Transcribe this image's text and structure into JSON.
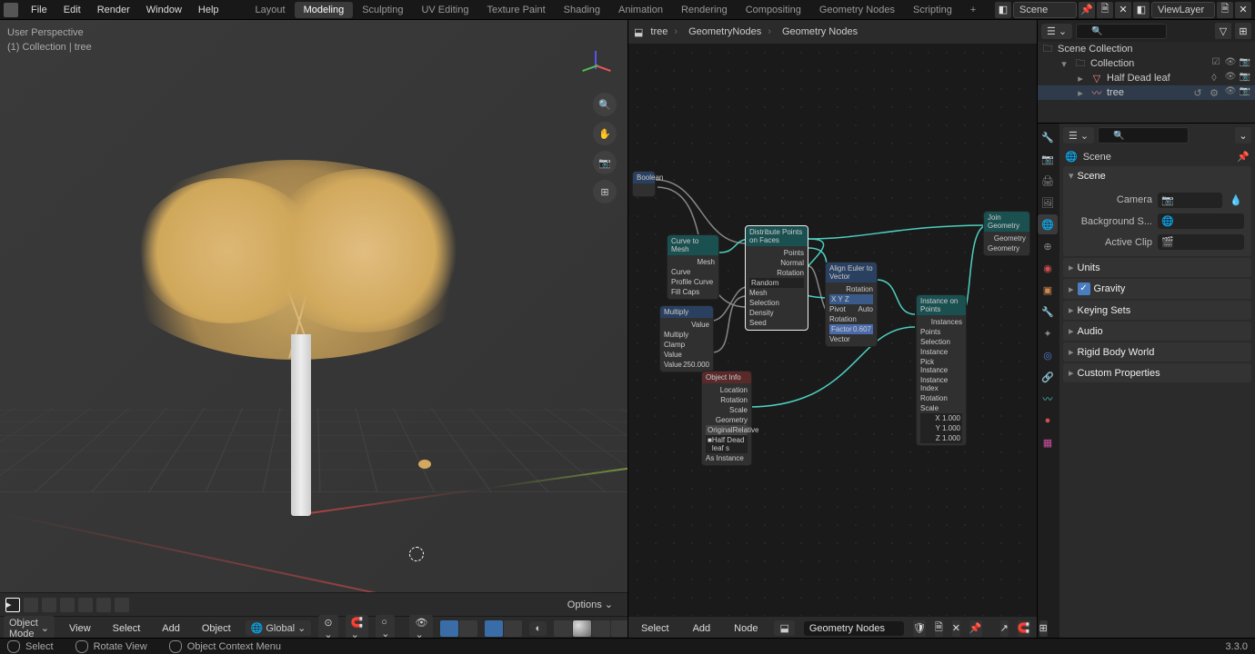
{
  "topbar": {
    "menus": [
      "File",
      "Edit",
      "Render",
      "Window",
      "Help"
    ],
    "workspaces": [
      "Layout",
      "Modeling",
      "Sculpting",
      "UV Editing",
      "Texture Paint",
      "Shading",
      "Animation",
      "Rendering",
      "Compositing",
      "Geometry Nodes",
      "Scripting"
    ],
    "active_workspace": "Modeling",
    "scene": "Scene",
    "view_layer": "ViewLayer"
  },
  "viewport": {
    "header_line1": "User Perspective",
    "header_line2": "(1) Collection | tree",
    "mode": "Object Mode",
    "menu": [
      "View",
      "Select",
      "Add",
      "Object"
    ],
    "orientation": "Global",
    "options": "Options"
  },
  "node_editor": {
    "breadcrumb": [
      "tree",
      "GeometryNodes",
      "Geometry Nodes"
    ],
    "menu": [
      "Select",
      "Add",
      "Node"
    ],
    "modifier_name": "Geometry Nodes",
    "nodes": {
      "boolean": "Boolean",
      "curve_to_mesh": {
        "title": "Curve to Mesh",
        "out": "Mesh",
        "in1": "Curve",
        "in2": "Profile Curve",
        "in3": "Fill Caps"
      },
      "multiply": {
        "title": "Multiply",
        "out": "Value",
        "op": "Multiply",
        "clamp": "Clamp",
        "in1": "Value",
        "in2": "Value",
        "val": "250.000"
      },
      "distribute": {
        "title": "Distribute Points on Faces",
        "o1": "Points",
        "o2": "Normal",
        "o3": "Rotation",
        "mode": "Random",
        "i1": "Mesh",
        "i2": "Selection",
        "i3": "Density",
        "i4": "Seed"
      },
      "align": {
        "title": "Align Euler to Vector",
        "out": "Rotation",
        "axes": "X  Y  Z",
        "pivot_lbl": "Pivot",
        "pivot": "Auto",
        "in1": "Rotation",
        "factor_lbl": "Factor",
        "factor": "0.607",
        "in2": "Vector"
      },
      "instance": {
        "title": "Instance on Points",
        "out": "Instances",
        "i1": "Points",
        "i2": "Selection",
        "i3": "Instance",
        "i4": "Pick Instance",
        "i5": "Instance Index",
        "i6": "Rotation",
        "i7": "Scale",
        "x": "X   1.000",
        "y": "Y   1.000",
        "z": "Z   1.000"
      },
      "object_info": {
        "title": "Object Info",
        "o1": "Location",
        "o2": "Rotation",
        "o3": "Scale",
        "o4": "Geometry",
        "mode1": "Original",
        "mode2": "Relative",
        "obj": "Half Dead leaf s",
        "as": "As Instance"
      },
      "join": {
        "title": "Join Geometry",
        "out": "Geometry",
        "in": "Geometry"
      }
    }
  },
  "outliner": {
    "root": "Scene Collection",
    "collection": "Collection",
    "items": [
      "Half Dead leaf",
      "tree"
    ]
  },
  "properties": {
    "context": "Scene",
    "scene_panel": "Scene",
    "camera": "Camera",
    "background": "Background S...",
    "active_clip": "Active Clip",
    "panels": [
      "Units",
      "Gravity",
      "Keying Sets",
      "Audio",
      "Rigid Body World",
      "Custom Properties"
    ]
  },
  "statusbar": {
    "select": "Select",
    "rotate": "Rotate View",
    "context": "Object Context Menu",
    "version": "3.3.0"
  }
}
